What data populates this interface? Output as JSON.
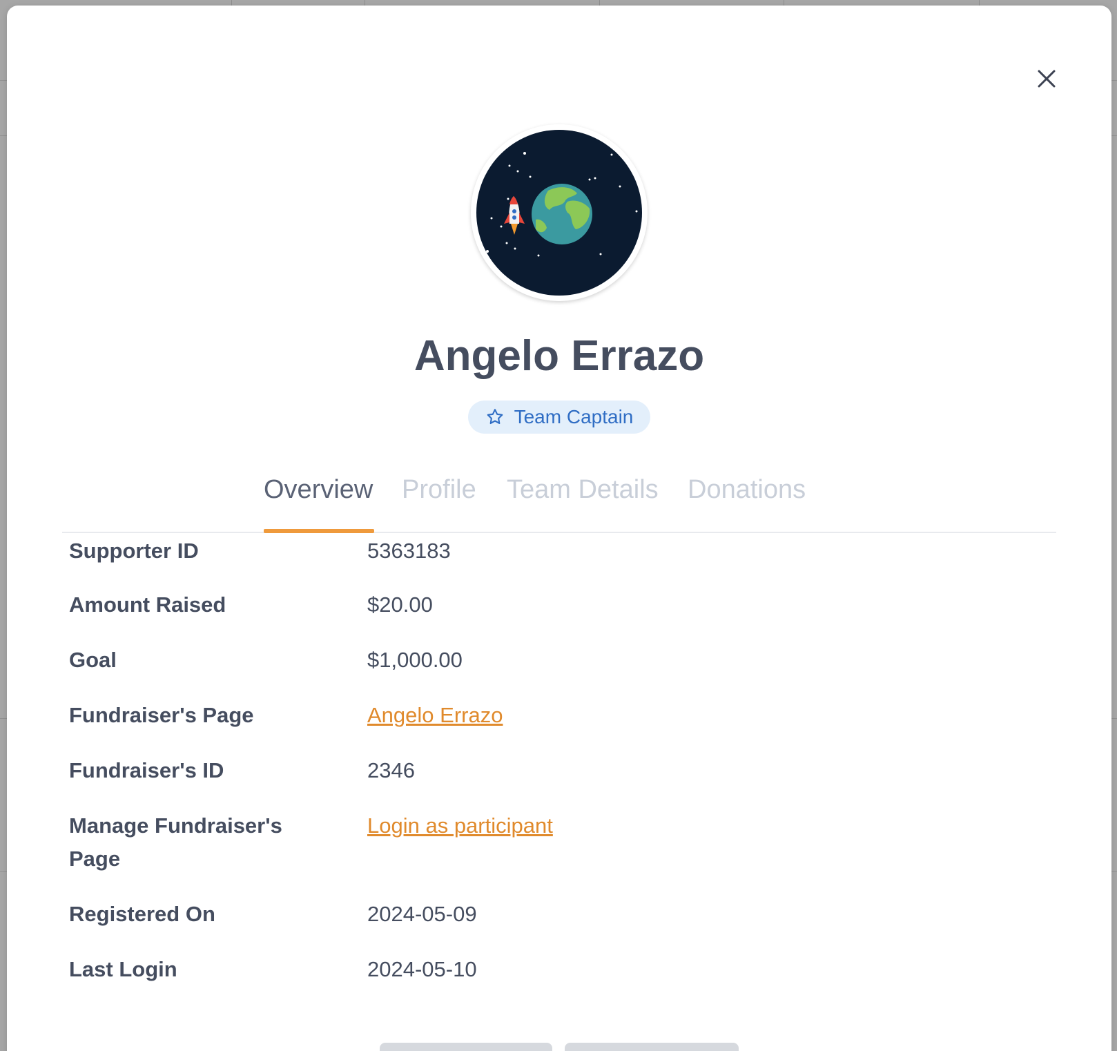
{
  "profile": {
    "name": "Angelo Errazo",
    "badge_label": "Team Captain"
  },
  "tabs": [
    {
      "label": "Overview",
      "active": true
    },
    {
      "label": "Profile",
      "active": false
    },
    {
      "label": "Team Details",
      "active": false
    },
    {
      "label": "Donations",
      "active": false
    }
  ],
  "details": {
    "supporter_id": {
      "label": "Supporter ID",
      "value": "5363183"
    },
    "amount_raised": {
      "label": "Amount Raised",
      "value": "$20.00"
    },
    "goal": {
      "label": "Goal",
      "value": "$1,000.00"
    },
    "fundraiser_page": {
      "label": "Fundraiser's Page",
      "value": "Angelo Errazo"
    },
    "fundraiser_id": {
      "label": "Fundraiser's ID",
      "value": "2346"
    },
    "manage_page": {
      "label": "Manage Fundraiser's Page",
      "value": "Login as participant"
    },
    "registered_on": {
      "label": "Registered On",
      "value": "2024-05-09"
    },
    "last_login": {
      "label": "Last Login",
      "value": "2024-05-10"
    }
  },
  "icons": {
    "close": "close-icon",
    "badge": "star-icon",
    "avatar": "rocket-earth-avatar"
  },
  "colors": {
    "accent": "#ef9a3c",
    "link": "#e08a2c",
    "badge_bg": "#e3effb",
    "badge_text": "#2f6dc4",
    "text_dark": "#454d5f",
    "tab_inactive": "#c8ced8"
  }
}
